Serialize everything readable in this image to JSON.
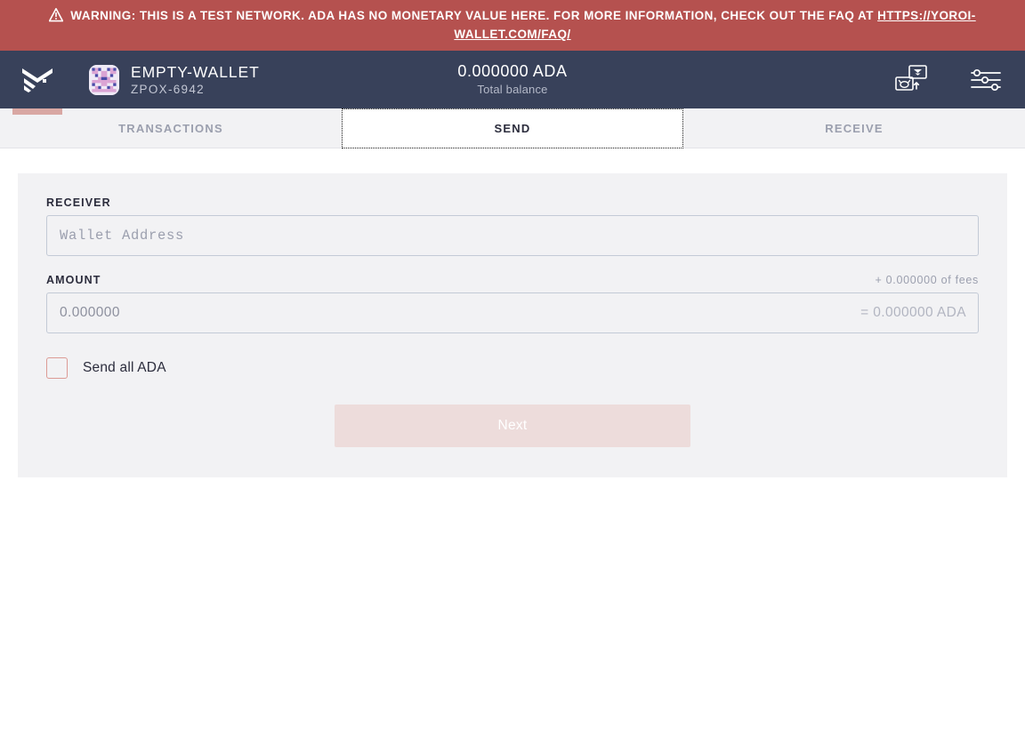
{
  "warning": {
    "icon": "warning-triangle-icon",
    "text_before": "WARNING: THIS IS A TEST NETWORK. ADA HAS NO MONETARY VALUE HERE. FOR MORE INFORMATION, CHECK OUT THE FAQ AT ",
    "link_text": "HTTPS://YOROI-WALLET.COM/FAQ/",
    "bg_color": "#b5514f",
    "text_color": "#ffffff"
  },
  "navbar": {
    "logo_icon": "yoroi-chevron-logo-icon",
    "avatar_icon": "wallet-identicon-avatar",
    "wallet_name": "EMPTY-WALLET",
    "wallet_plate": "ZPOX-6942",
    "balance_amount": "0.000000 ADA",
    "balance_label": "Total balance",
    "bg_color": "#38415a",
    "accent_color": "#d9a7a3",
    "actions": [
      {
        "icon": "switch-wallet-icon",
        "label": "Switch wallet"
      },
      {
        "icon": "settings-sliders-icon",
        "label": "Settings"
      }
    ]
  },
  "tabs": [
    {
      "label": "TRANSACTIONS",
      "active": false
    },
    {
      "label": "SEND",
      "active": true
    },
    {
      "label": "RECEIVE",
      "active": false
    }
  ],
  "form": {
    "receiver": {
      "label": "RECEIVER",
      "placeholder": "Wallet Address",
      "value": ""
    },
    "amount": {
      "label": "AMOUNT",
      "placeholder": "0.000000",
      "value": "",
      "fees_note": "+ 0.000000 of fees",
      "total_suffix": "= 0.000000 ADA"
    },
    "send_all": {
      "label": "Send all ADA",
      "checked": false,
      "border_color": "#dc9b95"
    },
    "submit": {
      "label": "Next",
      "disabled": true,
      "bg_color": "#eddcdb"
    }
  }
}
